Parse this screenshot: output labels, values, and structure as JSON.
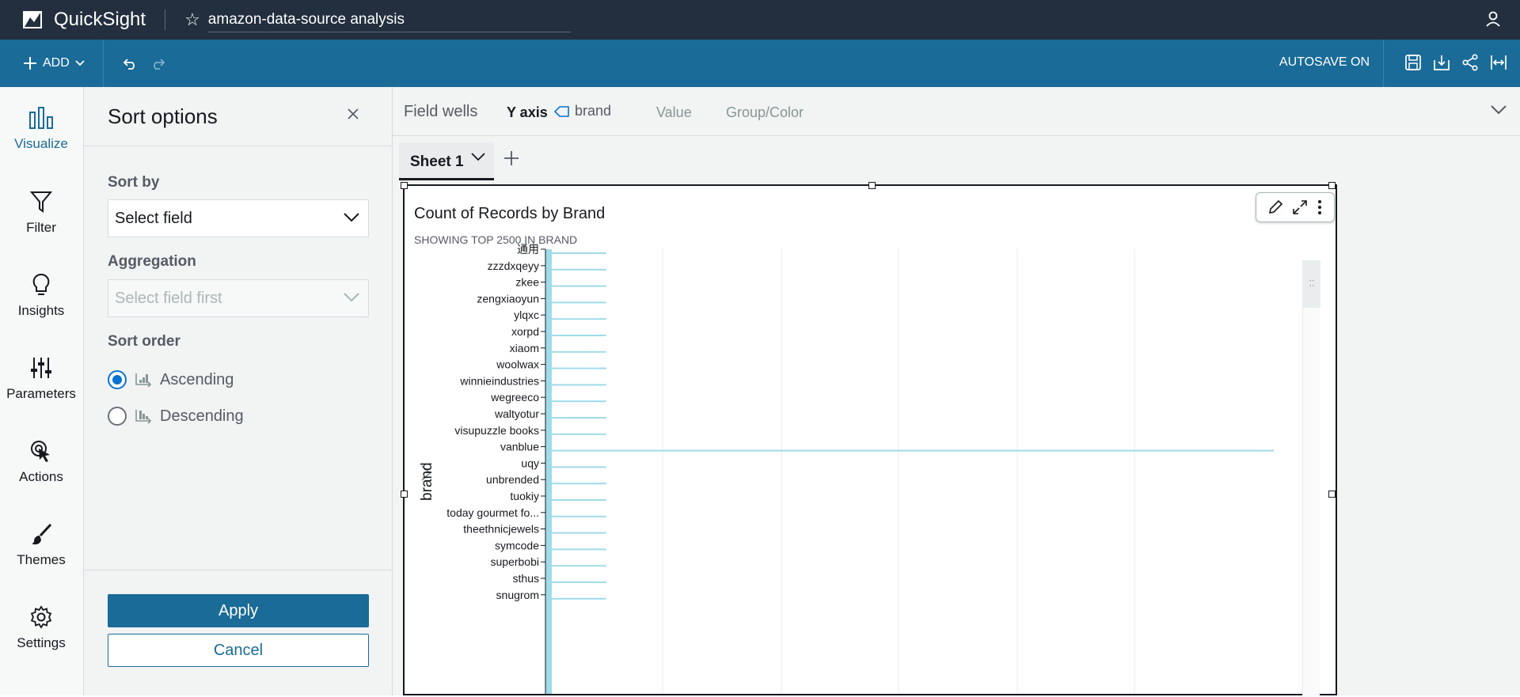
{
  "topbar": {
    "app_name": "QuickSight",
    "analysis_title": "amazon-data-source analysis",
    "icons": [
      "quicksight-logo-icon",
      "star-icon",
      "user-icon"
    ]
  },
  "toolbar": {
    "add_label": "ADD",
    "autosave_label": "AUTOSAVE ON",
    "icons": [
      "plus-icon",
      "chevron-down-icon",
      "undo-icon",
      "redo-icon",
      "save-icon",
      "export-icon",
      "share-icon",
      "fit-width-icon"
    ]
  },
  "leftnav": {
    "items": [
      {
        "label": "Visualize",
        "icon": "bar-chart-icon",
        "active": true
      },
      {
        "label": "Filter",
        "icon": "filter-icon"
      },
      {
        "label": "Insights",
        "icon": "lightbulb-icon"
      },
      {
        "label": "Parameters",
        "icon": "sliders-icon"
      },
      {
        "label": "Actions",
        "icon": "pointer-icon"
      },
      {
        "label": "Themes",
        "icon": "brush-icon"
      },
      {
        "label": "Settings",
        "icon": "gear-icon"
      }
    ]
  },
  "sort_panel": {
    "title": "Sort options",
    "sort_by_label": "Sort by",
    "sort_by_value": "Select field",
    "aggregation_label": "Aggregation",
    "aggregation_value": "Select field first",
    "sort_order_label": "Sort order",
    "ascending_label": "Ascending",
    "descending_label": "Descending",
    "selected_order": "Ascending",
    "apply_label": "Apply",
    "cancel_label": "Cancel"
  },
  "field_wells": {
    "title": "Field wells",
    "y_axis_label": "Y axis",
    "y_axis_field": "brand",
    "value_label": "Value",
    "group_label": "Group/Color"
  },
  "sheets": {
    "tabs": [
      {
        "label": "Sheet 1"
      }
    ]
  },
  "visual": {
    "title": "Count of Records by Brand",
    "subtitle": "SHOWING TOP 2500 IN BRAND",
    "accent_color": "#9fdbe9"
  },
  "chart_data": {
    "type": "bar",
    "orientation": "horizontal",
    "title": "Count of Records by Brand",
    "subtitle": "SHOWING TOP 2500 IN BRAND",
    "ylabel": "brand",
    "xlabel": "",
    "grid": true,
    "categories": [
      "通用",
      "zzzdxqeyy",
      "zkee",
      "zengxiaoyun",
      "ylqxc",
      "xorpd",
      "xiaom",
      "woolwax",
      "winnieindustries",
      "wegreeco",
      "waltyotur",
      "visupuzzle books",
      "vanblue",
      "uqy",
      "unbrended",
      "tuokiy",
      "today gourmet fo...",
      "theethnicjewels",
      "symcode",
      "superbobi",
      "sthus",
      "snugrom"
    ],
    "values": [
      1,
      1,
      1,
      1,
      1,
      1,
      1,
      1,
      1,
      1,
      1,
      1,
      12,
      1,
      1,
      1,
      1,
      1,
      1,
      1,
      1,
      1
    ]
  }
}
